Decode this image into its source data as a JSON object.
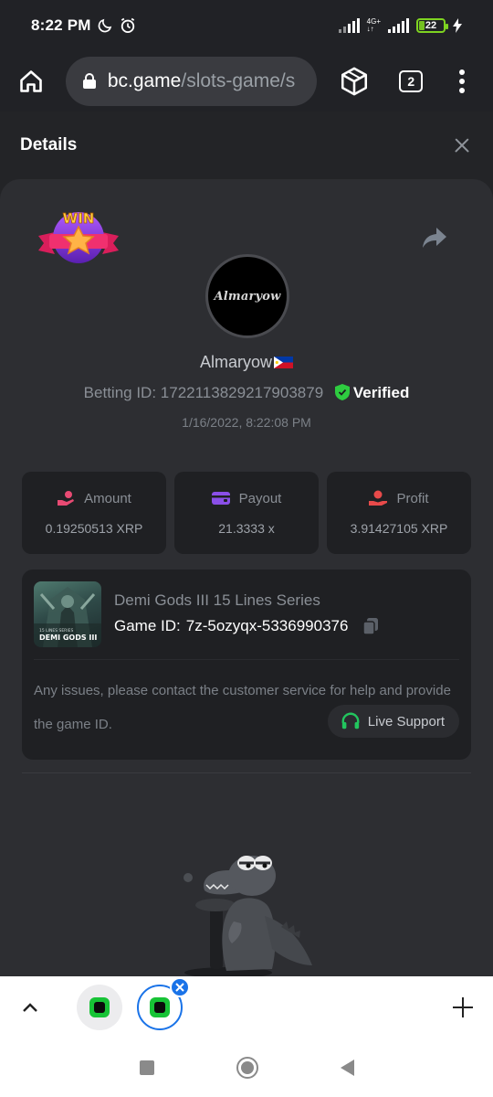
{
  "status_bar": {
    "time": "8:22 PM",
    "network": "4G+",
    "battery": "22"
  },
  "browser": {
    "url_host": "bc.game",
    "url_path": "/slots-game/s",
    "tab_count": "2"
  },
  "details": {
    "title": "Details",
    "badge_text": "WIN",
    "avatar_text": "Almaryow",
    "username": "Almaryow",
    "betting_label": "Betting ID:",
    "betting_id": "1722113829217903879",
    "verified_label": "Verified",
    "timestamp": "1/16/2022, 8:22:08 PM"
  },
  "stats": [
    {
      "label": "Amount",
      "value": "0.19250513 XRP",
      "icon": "coins-hand-icon",
      "color": "#e84a73"
    },
    {
      "label": "Payout",
      "value": "21.3333 x",
      "icon": "wallet-icon",
      "color": "#8a4fe8"
    },
    {
      "label": "Profit",
      "value": "3.91427105 XRP",
      "icon": "profit-hand-icon",
      "color": "#e84a4a"
    }
  ],
  "game": {
    "name": "Demi Gods III 15 Lines Series",
    "id_label": "Game ID:",
    "id_value": "7z-5ozyqx-5336990376",
    "thumb_title": "DEMI GODS III",
    "thumb_subtitle": "15 LINES SERIES",
    "issues_text": "Any issues, please contact the customer service for help and provide the game ID.",
    "support_label": "Live Support"
  },
  "colors": {
    "verified_green": "#2ecc40",
    "support_green": "#22c55e",
    "accent_blue": "#1a73e8"
  }
}
